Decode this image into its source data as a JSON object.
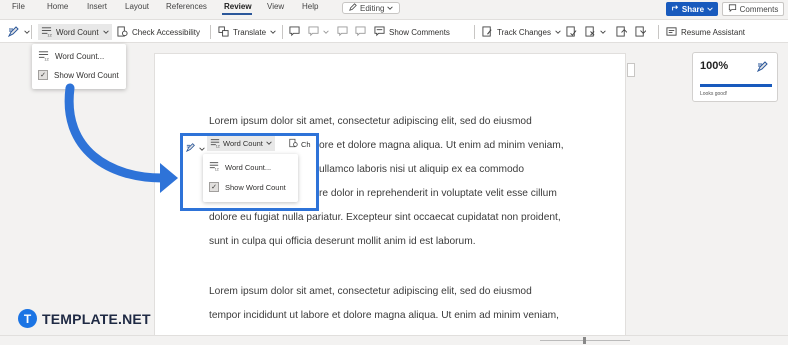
{
  "menu": {
    "items": [
      "File",
      "Home",
      "Insert",
      "Layout",
      "References",
      "Review",
      "View",
      "Help"
    ],
    "active": "Review",
    "editing_label": "Editing",
    "share_label": "Share",
    "comments_label": "Comments"
  },
  "ribbon": {
    "word_count": "Word Count",
    "check_accessibility": "Check Accessibility",
    "translate": "Translate",
    "show_comments": "Show Comments",
    "track_changes": "Track Changes",
    "resume_assistant": "Resume Assistant"
  },
  "word_count_menu": {
    "item_word_count": "Word Count...",
    "item_show_word_count": "Show Word Count",
    "show_word_count_checked": true
  },
  "callout": {
    "word_count": "Word Count",
    "check_fragment": "Ch",
    "item_word_count": "Word Count...",
    "item_show_word_count": "Show Word Count"
  },
  "editor": {
    "score": "100%",
    "caption": "Looks good!"
  },
  "document": {
    "lines": [
      "Lorem ipsum dolor sit amet, consectetur adipiscing elit, sed do eiusmod",
      "ore et dolore magna aliqua. Ut enim ad minim veniam,",
      "ullamco laboris nisi ut aliquip ex ea commodo",
      "re dolor in reprehenderit in voluptate velit esse cillum",
      "dolore eu fugiat nulla pariatur. Excepteur sint occaecat cupidatat non proident,",
      "sunt in culpa qui officia deserunt mollit anim id est laborum.",
      "Lorem ipsum dolor sit amet, consectetur adipiscing elit, sed do eiusmod",
      "tempor incididunt ut labore et dolore magna aliqua. Ut enim ad minim veniam,"
    ]
  },
  "brand": {
    "mark": "T",
    "name": "TEMPLATE.NET"
  },
  "colors": {
    "accent": "#185abd",
    "callout_border": "#2e73d8",
    "arrow": "#2e73d8"
  }
}
